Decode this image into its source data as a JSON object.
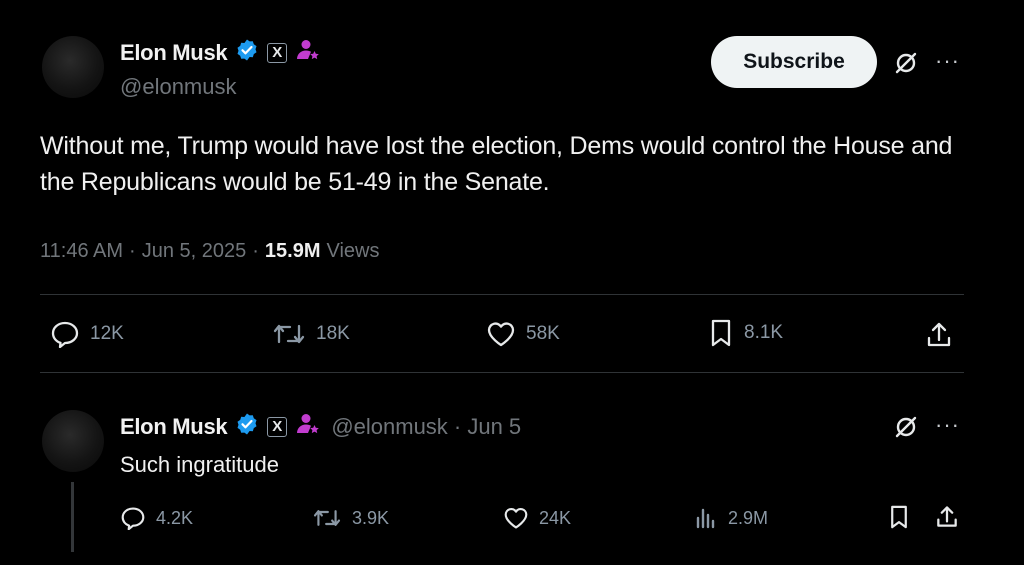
{
  "main_tweet": {
    "author_name": "Elon Musk",
    "handle": "@elonmusk",
    "subscribe_label": "Subscribe",
    "more_label": "···",
    "x_badge": "X",
    "text": "Without me, Trump would have lost the election, Dems would control the House and the Republicans would be 51-49 in the Senate.",
    "time": "11:46 AM",
    "date": "Jun 5, 2025",
    "separator": "·",
    "views_count": "15.9M",
    "views_label": "Views",
    "actions": {
      "replies": "12K",
      "reposts": "18K",
      "likes": "58K",
      "bookmarks": "8.1K"
    }
  },
  "reply_tweet": {
    "author_name": "Elon Musk",
    "handle_date": "@elonmusk · Jun 5",
    "x_badge": "X",
    "more_label": "···",
    "text": "Such ingratitude",
    "actions": {
      "replies": "4.2K",
      "reposts": "3.9K",
      "likes": "24K",
      "views": "2.9M"
    }
  },
  "colors": {
    "background": "#000000",
    "verified": "#1d9bf0",
    "affiliate": "#c13ccf",
    "muted": "#71767b"
  },
  "icons": [
    "verified-badge-icon",
    "x-badge-icon",
    "affiliate-icon",
    "grok-icon",
    "more-icon",
    "reply-icon",
    "repost-icon",
    "like-icon",
    "bookmark-icon",
    "share-icon",
    "views-icon"
  ]
}
